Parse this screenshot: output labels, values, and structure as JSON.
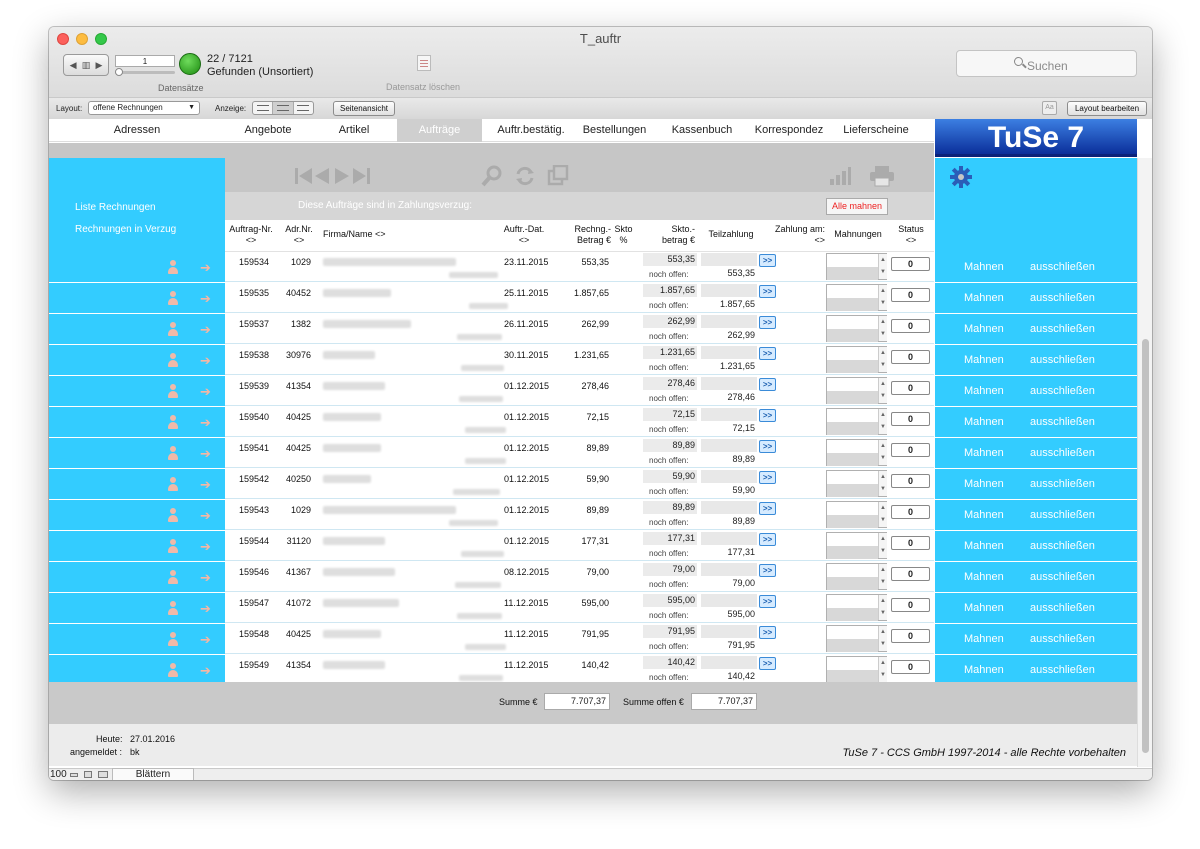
{
  "window": {
    "title": "T_auftr"
  },
  "toolbar": {
    "record_input": "1",
    "record_count": "22 / 7121",
    "found_status": "Gefunden (Unsortiert)",
    "records_label": "Datensätze",
    "delete_record_label": "Datensatz löschen",
    "search_placeholder": "Suchen"
  },
  "layoutbar": {
    "layout_label": "Layout:",
    "layout_value": "offene Rechnungen",
    "view_label": "Anzeige:",
    "page_view_button": "Seitenansicht",
    "edit_layout_button": "Layout bearbeiten"
  },
  "nav": {
    "tabs": [
      {
        "label": "Adressen"
      },
      {
        "label": "Angebote"
      },
      {
        "label": "Artikel"
      },
      {
        "label": "Aufträge"
      },
      {
        "label": "Auftr.bestätig."
      },
      {
        "label": "Bestellungen"
      },
      {
        "label": "Kassenbuch"
      },
      {
        "label": "Korrespondez"
      },
      {
        "label": "Lieferscheine"
      }
    ],
    "active": "Aufträge",
    "logo": "TuSe 7"
  },
  "sidebar": {
    "items": [
      {
        "label": "Liste Rechnungen"
      },
      {
        "label": "Rechnungen in Verzug"
      }
    ]
  },
  "alert": {
    "text": "Diese Aufträge  sind in Zahlungsverzug:",
    "button": "Alle mahnen"
  },
  "table": {
    "headers": {
      "auftrag_nr": "Auftrag-Nr.",
      "auftrag_sort": "<>",
      "adr_nr": "Adr.Nr.",
      "adr_sort": "<>",
      "firma": "Firma/Name <>",
      "datum": "Auftr.-Dat.",
      "datum_sort": "<>",
      "rechng1": "Rechng.-",
      "rechng2": "Betrag €",
      "skto1": "Skto",
      "skto2": "%",
      "sktob1": "Skto.-",
      "sktob2": "betrag €",
      "teilzahlung": "Teilzahlung",
      "zahlung1": "Zahlung am:",
      "zahlung2": "<>",
      "mahnungen": "Mahnungen",
      "status1": "Status",
      "status2": "<>"
    },
    "noch_offen_label": "noch offen:",
    "pay_button": ">>",
    "action_mahnen": "Mahnen",
    "action_ausschliessen": "ausschließen",
    "rows": [
      {
        "auftrag": "159534",
        "adr": "1029",
        "datum": "23.11.2015",
        "betrag": "553,35",
        "skto_betrag": "553,35",
        "offen": "553,35",
        "status": "0"
      },
      {
        "auftrag": "159535",
        "adr": "40452",
        "datum": "25.11.2015",
        "betrag": "1.857,65",
        "skto_betrag": "1.857,65",
        "offen": "1.857,65",
        "status": "0"
      },
      {
        "auftrag": "159537",
        "adr": "1382",
        "datum": "26.11.2015",
        "betrag": "262,99",
        "skto_betrag": "262,99",
        "offen": "262,99",
        "status": "0"
      },
      {
        "auftrag": "159538",
        "adr": "30976",
        "datum": "30.11.2015",
        "betrag": "1.231,65",
        "skto_betrag": "1.231,65",
        "offen": "1.231,65",
        "status": "0"
      },
      {
        "auftrag": "159539",
        "adr": "41354",
        "datum": "01.12.2015",
        "betrag": "278,46",
        "skto_betrag": "278,46",
        "offen": "278,46",
        "status": "0"
      },
      {
        "auftrag": "159540",
        "adr": "40425",
        "datum": "01.12.2015",
        "betrag": "72,15",
        "skto_betrag": "72,15",
        "offen": "72,15",
        "status": "0"
      },
      {
        "auftrag": "159541",
        "adr": "40425",
        "datum": "01.12.2015",
        "betrag": "89,89",
        "skto_betrag": "89,89",
        "offen": "89,89",
        "status": "0"
      },
      {
        "auftrag": "159542",
        "adr": "40250",
        "datum": "01.12.2015",
        "betrag": "59,90",
        "skto_betrag": "59,90",
        "offen": "59,90",
        "status": "0"
      },
      {
        "auftrag": "159543",
        "adr": "1029",
        "datum": "01.12.2015",
        "betrag": "89,89",
        "skto_betrag": "89,89",
        "offen": "89,89",
        "status": "0"
      },
      {
        "auftrag": "159544",
        "adr": "31120",
        "datum": "01.12.2015",
        "betrag": "177,31",
        "skto_betrag": "177,31",
        "offen": "177,31",
        "status": "0"
      },
      {
        "auftrag": "159546",
        "adr": "41367",
        "datum": "08.12.2015",
        "betrag": "79,00",
        "skto_betrag": "79,00",
        "offen": "79,00",
        "status": "0"
      },
      {
        "auftrag": "159547",
        "adr": "41072",
        "datum": "11.12.2015",
        "betrag": "595,00",
        "skto_betrag": "595,00",
        "offen": "595,00",
        "status": "0"
      },
      {
        "auftrag": "159548",
        "adr": "40425",
        "datum": "11.12.2015",
        "betrag": "791,95",
        "skto_betrag": "791,95",
        "offen": "791,95",
        "status": "0"
      },
      {
        "auftrag": "159549",
        "adr": "41354",
        "datum": "11.12.2015",
        "betrag": "140,42",
        "skto_betrag": "140,42",
        "offen": "140,42",
        "status": "0"
      }
    ]
  },
  "footer": {
    "summe_label": "Summe €",
    "summe": "7.707,37",
    "summe_offen_label": "Summe offen €",
    "summe_offen": "7.707,37"
  },
  "info": {
    "heute_label": "Heute:",
    "heute": "27.01.2016",
    "angemeldet_label": "angemeldet :",
    "angemeldet": "bk",
    "copyright": "TuSe 7 - CCS GmbH 1997-2014 - alle Rechte vorbehalten"
  },
  "statusbar": {
    "zoom": "100",
    "mode": "Blättern"
  },
  "colors": {
    "accent": "#33ccff",
    "logo": "#1a4fc0",
    "alert_button": "#e22222"
  }
}
